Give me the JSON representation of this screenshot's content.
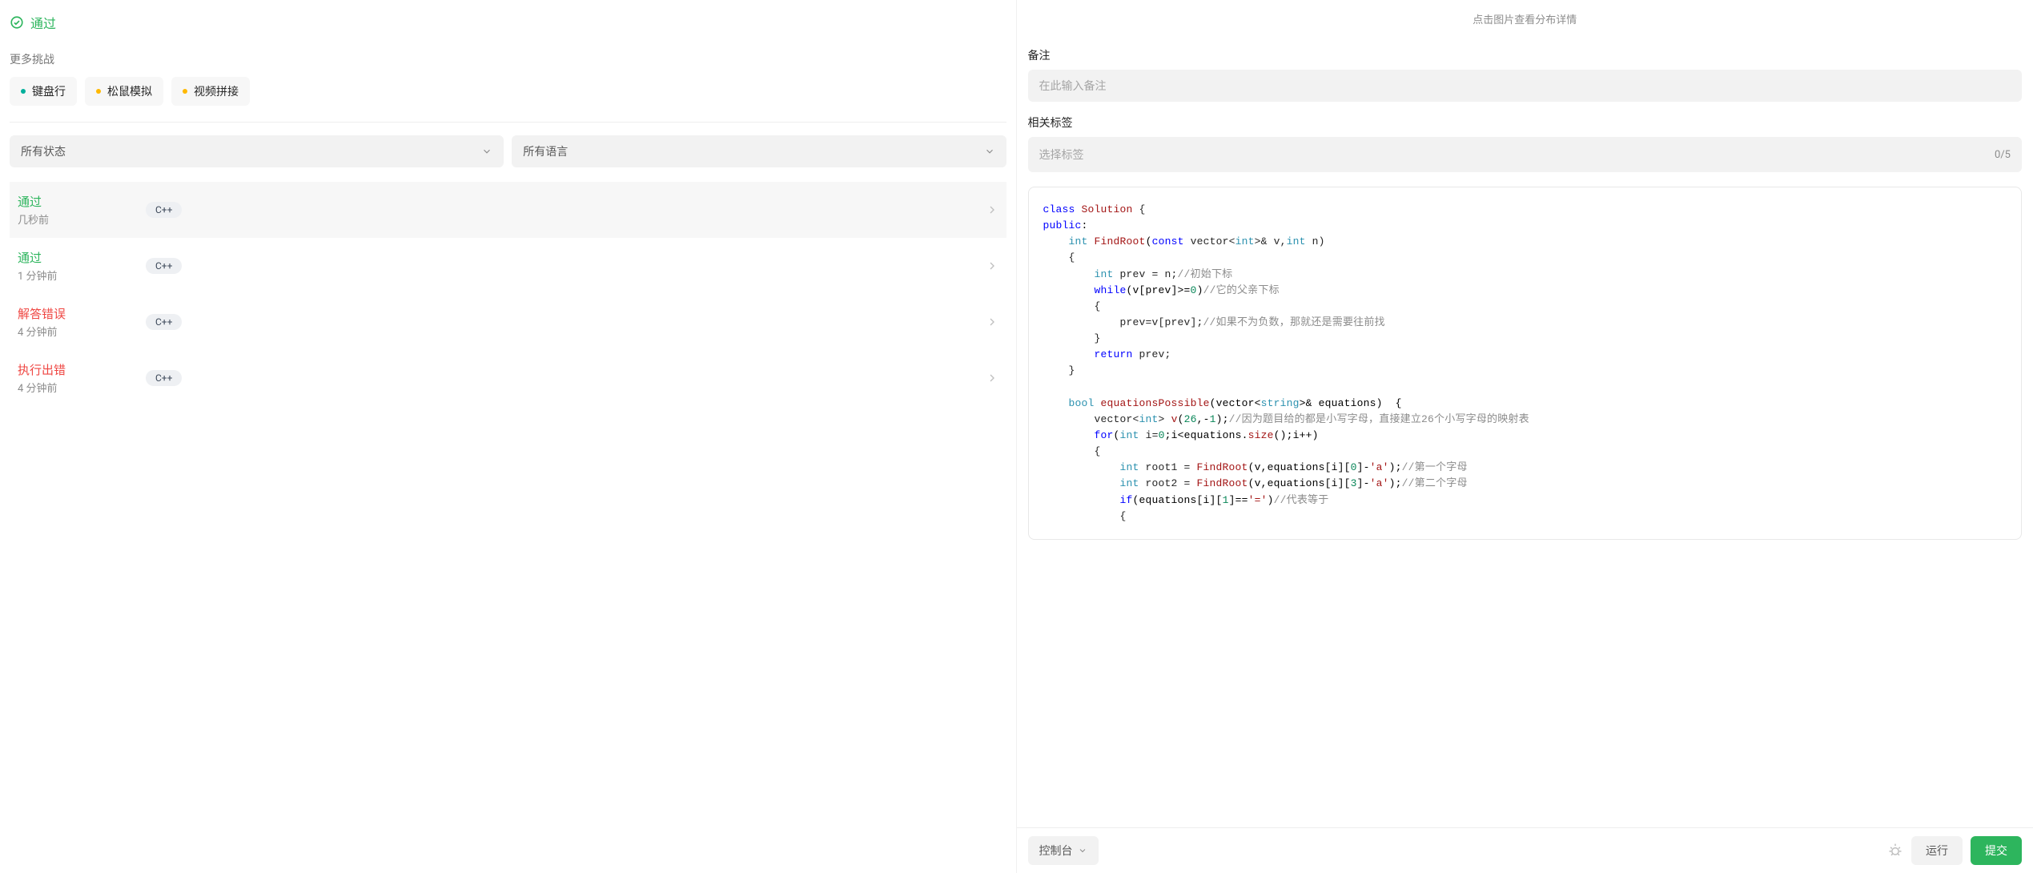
{
  "left": {
    "header_status": "通过",
    "more_challenges_label": "更多挑战",
    "challenges": [
      {
        "label": "键盘行",
        "dot": "green"
      },
      {
        "label": "松鼠模拟",
        "dot": "yellow"
      },
      {
        "label": "视频拼接",
        "dot": "yellow"
      }
    ],
    "filters": {
      "status_label": "所有状态",
      "language_label": "所有语言"
    },
    "submissions": [
      {
        "status": "通过",
        "status_kind": "pass",
        "time": "几秒前",
        "lang": "C++",
        "active": true
      },
      {
        "status": "通过",
        "status_kind": "pass",
        "time": "1 分钟前",
        "lang": "C++",
        "active": false
      },
      {
        "status": "解答错误",
        "status_kind": "fail",
        "time": "4 分钟前",
        "lang": "C++",
        "active": false
      },
      {
        "status": "执行出错",
        "status_kind": "fail",
        "time": "4 分钟前",
        "lang": "C++",
        "active": false
      }
    ]
  },
  "right": {
    "hint_text": "点击图片查看分布详情",
    "remark_label": "备注",
    "remark_placeholder": "在此输入备注",
    "tags_label": "相关标签",
    "tags_placeholder": "选择标签",
    "tags_count": "0/5",
    "bottom": {
      "console_label": "控制台",
      "run_label": "运行",
      "submit_label": "提交"
    },
    "code_tokens": [
      [
        [
          "kw",
          "class"
        ],
        [
          "sp",
          " "
        ],
        [
          "cls",
          "Solution"
        ],
        [
          "sp",
          " {"
        ]
      ],
      [
        [
          "kw",
          "public"
        ],
        [
          "op",
          ":"
        ]
      ],
      [
        [
          "sp",
          "    "
        ],
        [
          "type",
          "int"
        ],
        [
          "sp",
          " "
        ],
        [
          "fn",
          "FindRoot"
        ],
        [
          "op",
          "("
        ],
        [
          "kw",
          "const"
        ],
        [
          "sp",
          " vector<"
        ],
        [
          "type",
          "int"
        ],
        [
          "sp",
          ">& v,"
        ],
        [
          "type",
          "int"
        ],
        [
          "sp",
          " n)"
        ]
      ],
      [
        [
          "sp",
          "    {"
        ]
      ],
      [
        [
          "sp",
          "        "
        ],
        [
          "type",
          "int"
        ],
        [
          "sp",
          " prev = n;"
        ],
        [
          "comment",
          "//初始下标"
        ]
      ],
      [
        [
          "sp",
          "        "
        ],
        [
          "kw",
          "while"
        ],
        [
          "op",
          "(v[prev]>="
        ],
        [
          "num",
          "0"
        ],
        [
          "op",
          ")"
        ],
        [
          "comment",
          "//它的父亲下标"
        ]
      ],
      [
        [
          "sp",
          "        {"
        ]
      ],
      [
        [
          "sp",
          "            prev=v[prev];"
        ],
        [
          "comment",
          "//如果不为负数，那就还是需要往前找"
        ]
      ],
      [
        [
          "sp",
          "        }"
        ]
      ],
      [
        [
          "sp",
          "        "
        ],
        [
          "kw",
          "return"
        ],
        [
          "sp",
          " prev;"
        ]
      ],
      [
        [
          "sp",
          "    }"
        ]
      ],
      [
        [
          "sp",
          ""
        ]
      ],
      [
        [
          "sp",
          "    "
        ],
        [
          "type",
          "bool"
        ],
        [
          "sp",
          " "
        ],
        [
          "fn",
          "equationsPossible"
        ],
        [
          "op",
          "(vector<"
        ],
        [
          "type",
          "string"
        ],
        [
          "op",
          ">& equations)  {"
        ]
      ],
      [
        [
          "sp",
          "        vector<"
        ],
        [
          "type",
          "int"
        ],
        [
          "sp",
          "> "
        ],
        [
          "fn",
          "v"
        ],
        [
          "op",
          "("
        ],
        [
          "num",
          "26"
        ],
        [
          "op",
          ",-"
        ],
        [
          "num",
          "1"
        ],
        [
          "op",
          ");"
        ],
        [
          "comment",
          "//因为题目给的都是小写字母，直接建立26个小写字母的映射表"
        ]
      ],
      [
        [
          "sp",
          "        "
        ],
        [
          "kw",
          "for"
        ],
        [
          "op",
          "("
        ],
        [
          "type",
          "int"
        ],
        [
          "sp",
          " i="
        ],
        [
          "num",
          "0"
        ],
        [
          "op",
          ";i<equations."
        ],
        [
          "fn",
          "size"
        ],
        [
          "op",
          "();i++)"
        ]
      ],
      [
        [
          "sp",
          "        {"
        ]
      ],
      [
        [
          "sp",
          "            "
        ],
        [
          "type",
          "int"
        ],
        [
          "sp",
          " root1 = "
        ],
        [
          "fn",
          "FindRoot"
        ],
        [
          "op",
          "(v,equations[i]["
        ],
        [
          "num",
          "0"
        ],
        [
          "op",
          "]-"
        ],
        [
          "str",
          "'a'"
        ],
        [
          "op",
          ");"
        ],
        [
          "comment",
          "//第一个字母"
        ]
      ],
      [
        [
          "sp",
          "            "
        ],
        [
          "type",
          "int"
        ],
        [
          "sp",
          " root2 = "
        ],
        [
          "fn",
          "FindRoot"
        ],
        [
          "op",
          "(v,equations[i]["
        ],
        [
          "num",
          "3"
        ],
        [
          "op",
          "]-"
        ],
        [
          "str",
          "'a'"
        ],
        [
          "op",
          ");"
        ],
        [
          "comment",
          "//第二个字母"
        ]
      ],
      [
        [
          "sp",
          "            "
        ],
        [
          "kw",
          "if"
        ],
        [
          "op",
          "(equations[i]["
        ],
        [
          "num",
          "1"
        ],
        [
          "op",
          "]=="
        ],
        [
          "str",
          "'='"
        ],
        [
          "op",
          ")"
        ],
        [
          "comment",
          "//代表等于"
        ]
      ],
      [
        [
          "sp",
          "            {"
        ]
      ]
    ]
  }
}
